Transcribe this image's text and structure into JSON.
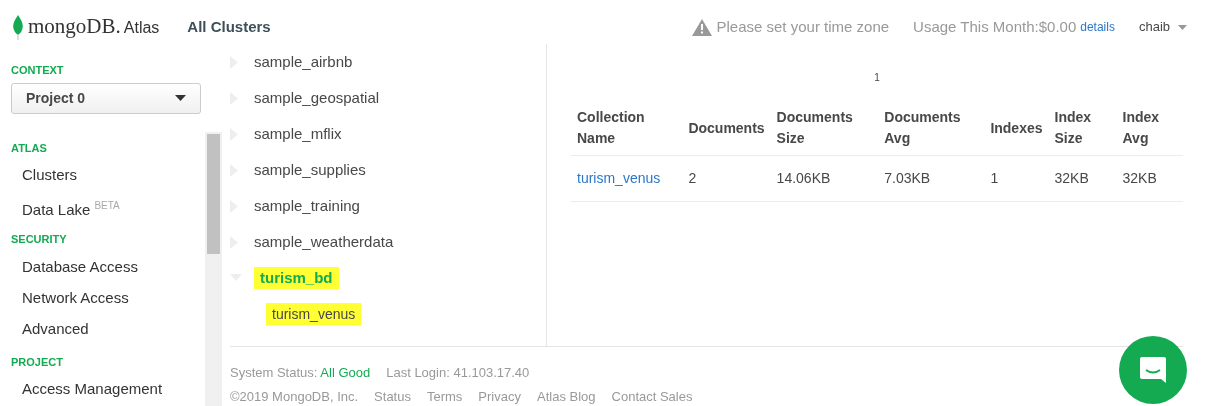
{
  "header": {
    "brand_name": "mongoDB.",
    "brand": "Atlas",
    "title": "All Clusters",
    "timezone_warning": "Please set your time zone",
    "usage": "Usage This Month:$0.00",
    "usage_link": "details",
    "user": "chaib"
  },
  "sidebar": {
    "context_label": "CONTEXT",
    "project_select": "Project 0",
    "sections": [
      {
        "heading": "ATLAS",
        "items": [
          {
            "label": "Clusters"
          },
          {
            "label": "Data Lake",
            "badge": "BETA"
          }
        ]
      },
      {
        "heading": "SECURITY",
        "items": [
          {
            "label": "Database Access"
          },
          {
            "label": "Network Access"
          },
          {
            "label": "Advanced"
          }
        ]
      },
      {
        "heading": "PROJECT",
        "items": [
          {
            "label": "Access Management"
          }
        ]
      }
    ]
  },
  "tree": [
    {
      "label": "sample_airbnb",
      "expanded": false,
      "highlighted": false
    },
    {
      "label": "sample_geospatial",
      "expanded": false,
      "highlighted": false
    },
    {
      "label": "sample_mflix",
      "expanded": false,
      "highlighted": false
    },
    {
      "label": "sample_supplies",
      "expanded": false,
      "highlighted": false
    },
    {
      "label": "sample_training",
      "expanded": false,
      "highlighted": false
    },
    {
      "label": "sample_weatherdata",
      "expanded": false,
      "highlighted": false
    },
    {
      "label": "turism_bd",
      "expanded": true,
      "highlighted": true,
      "children": [
        {
          "label": "turism_venus",
          "highlighted": true
        }
      ]
    }
  ],
  "table": {
    "page": "1",
    "columns": [
      "Collection Name",
      "Documents",
      "Documents Size",
      "Documents Avg",
      "Indexes",
      "Index Size",
      "Index Avg"
    ],
    "rows": [
      [
        "turism_venus",
        "2",
        "14.06KB",
        "7.03KB",
        "1",
        "32KB",
        "32KB"
      ]
    ]
  },
  "footer": {
    "status_label": "System Status:",
    "status_value": "All Good",
    "last_login": "Last Login: 41.103.17.40",
    "copyright": "©2019 MongoDB, Inc.",
    "links": [
      "Status",
      "Terms",
      "Privacy",
      "Atlas Blog",
      "Contact Sales"
    ]
  }
}
